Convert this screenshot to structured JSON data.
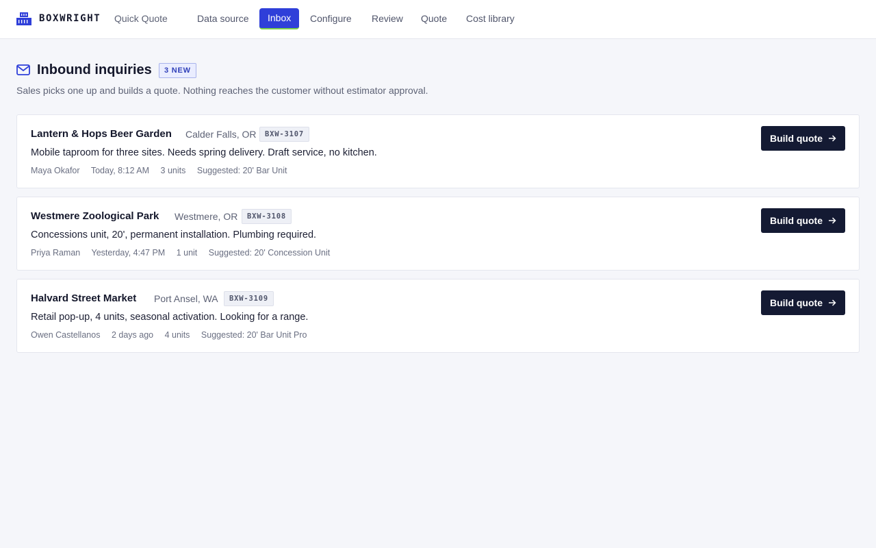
{
  "app": {
    "brand": "BOXWRIGHT",
    "product": "Quick Quote",
    "accent_color": "#2f3fd9",
    "dark_color": "#141a33"
  },
  "nav": {
    "items": [
      {
        "label": "Data source",
        "active": false
      },
      {
        "label": "Inbox",
        "active": true
      },
      {
        "label": "Configure",
        "active": false
      },
      {
        "label": "Review",
        "active": false
      },
      {
        "label": "Quote",
        "active": false
      },
      {
        "label": "Cost library",
        "active": false
      }
    ]
  },
  "page": {
    "icon": "mail-icon",
    "title": "Inbound inquiries",
    "badge": "3 NEW",
    "subtitle": "Sales picks one up and builds a quote. Nothing reaches the customer without estimator approval."
  },
  "inquiries": [
    {
      "name": "Lantern & Hops Beer Garden",
      "location": "Calder Falls, OR",
      "ref": "BXW-3107",
      "description": "Mobile taproom for three sites. Needs spring delivery. Draft service, no kitchen.",
      "contact": "Maya Okafor",
      "time": "Today, 8:12 AM",
      "units": "3 units",
      "suggested": "Suggested: 20' Bar Unit",
      "action": "Build quote"
    },
    {
      "name": "Westmere Zoological Park",
      "location": "Westmere, OR",
      "ref": "BXW-3108",
      "description": "Concessions unit, 20', permanent installation. Plumbing required.",
      "contact": "Priya Raman",
      "time": "Yesterday, 4:47 PM",
      "units": "1 unit",
      "suggested": "Suggested: 20' Concession Unit",
      "action": "Build quote"
    },
    {
      "name": "Halvard Street Market",
      "location": "Port Ansel, WA",
      "ref": "BXW-3109",
      "description": "Retail pop-up, 4 units, seasonal activation. Looking for a range.",
      "contact": "Owen Castellanos",
      "time": "2 days ago",
      "units": "4 units",
      "suggested": "Suggested: 20' Bar Unit Pro",
      "action": "Build quote"
    }
  ]
}
